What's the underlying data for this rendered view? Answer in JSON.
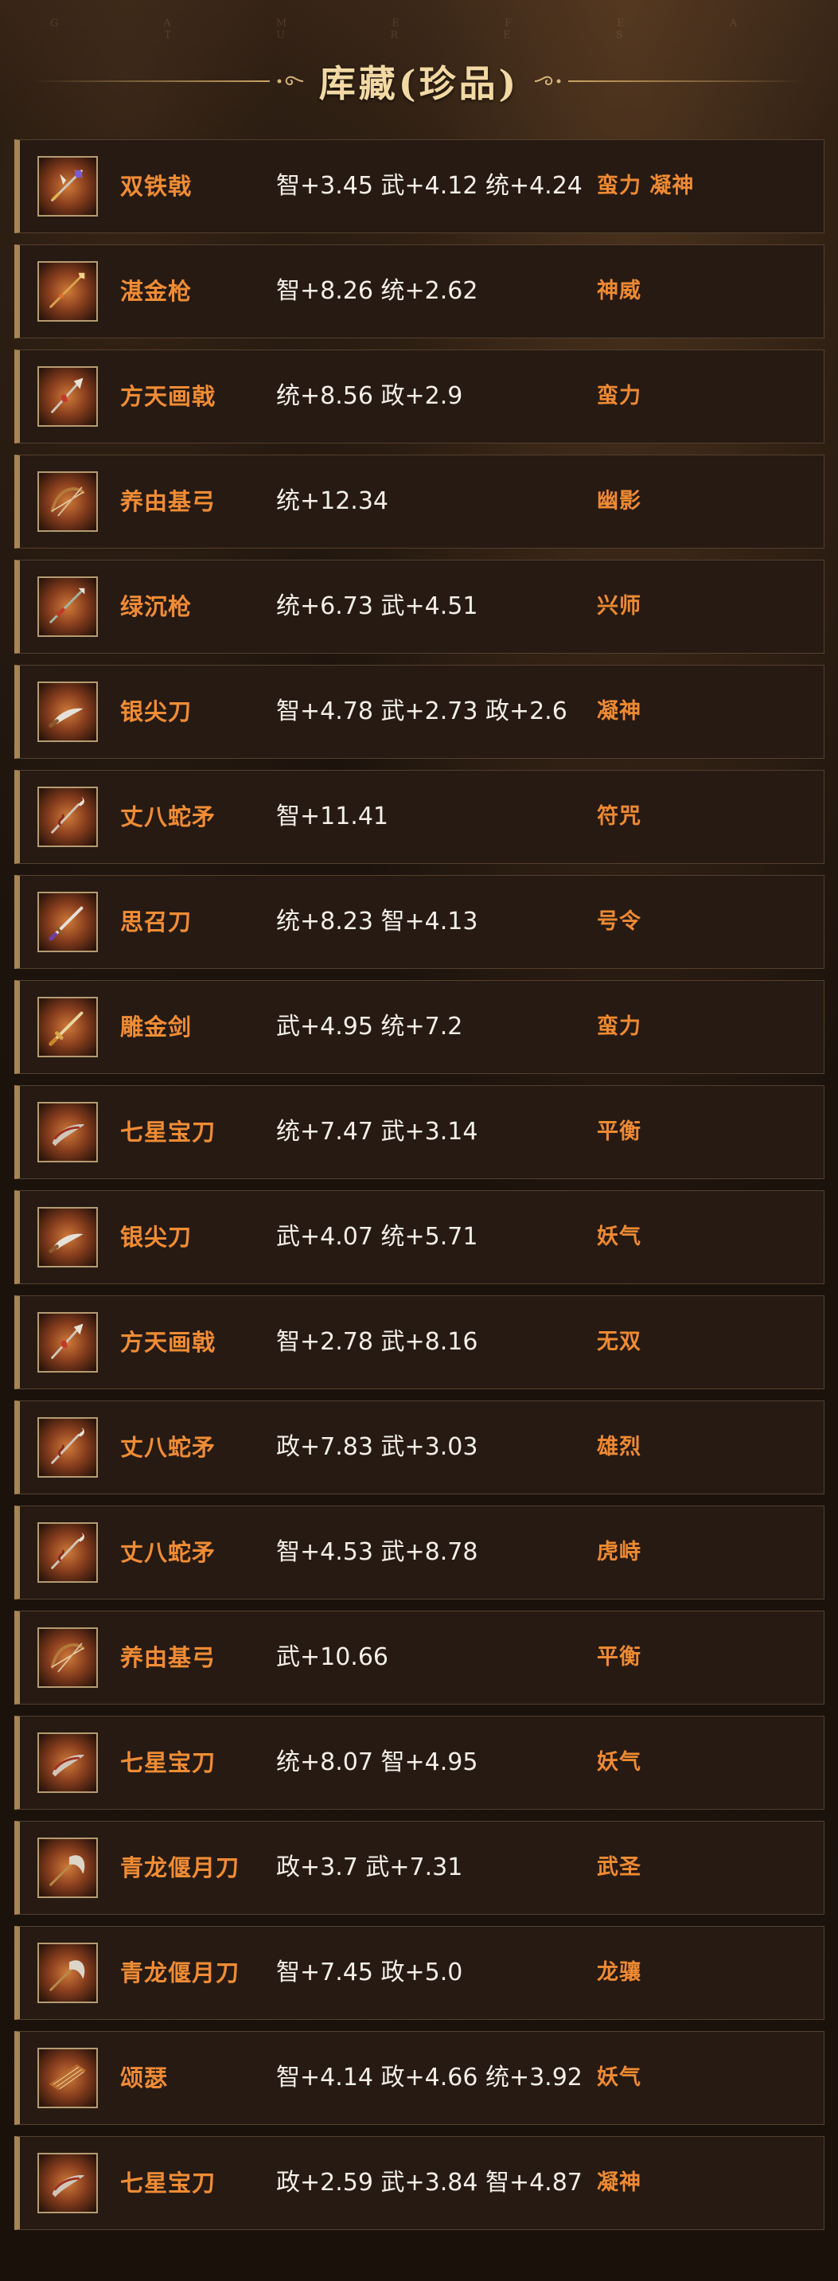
{
  "header": {
    "features_text": "G A M E  F E A T U R E S",
    "title": "库藏(珍品)"
  },
  "items": [
    {
      "name": "双铁戟",
      "stats": "智+3.45 武+4.12 统+4.24",
      "traits": "蛮力 凝神",
      "icon": "double-halberd-icon"
    },
    {
      "name": "湛金枪",
      "stats": "智+8.26 统+2.62",
      "traits": "神威",
      "icon": "golden-spear-icon"
    },
    {
      "name": "方天画戟",
      "stats": "统+8.56 政+2.9",
      "traits": "蛮力",
      "icon": "halberd-icon"
    },
    {
      "name": "养由基弓",
      "stats": "统+12.34",
      "traits": "幽影",
      "icon": "bow-icon"
    },
    {
      "name": "绿沉枪",
      "stats": "统+6.73 武+4.51",
      "traits": "兴师",
      "icon": "spear-icon"
    },
    {
      "name": "银尖刀",
      "stats": "智+4.78 武+2.73 政+2.6",
      "traits": "凝神",
      "icon": "silver-blade-icon"
    },
    {
      "name": "丈八蛇矛",
      "stats": "智+11.41",
      "traits": "符咒",
      "icon": "serpent-spear-icon"
    },
    {
      "name": "思召刀",
      "stats": "统+8.23 智+4.13",
      "traits": "号令",
      "icon": "sword-icon"
    },
    {
      "name": "雕金剑",
      "stats": "武+4.95 统+7.2",
      "traits": "蛮力",
      "icon": "gold-sword-icon"
    },
    {
      "name": "七星宝刀",
      "stats": "统+7.47 武+3.14",
      "traits": "平衡",
      "icon": "seven-star-blade-icon"
    },
    {
      "name": "银尖刀",
      "stats": "武+4.07 统+5.71",
      "traits": "妖气",
      "icon": "silver-blade-icon"
    },
    {
      "name": "方天画戟",
      "stats": "智+2.78 武+8.16",
      "traits": "无双",
      "icon": "halberd-icon"
    },
    {
      "name": "丈八蛇矛",
      "stats": "政+7.83 武+3.03",
      "traits": "雄烈",
      "icon": "serpent-spear-icon"
    },
    {
      "name": "丈八蛇矛",
      "stats": "智+4.53 武+8.78",
      "traits": "虎峙",
      "icon": "serpent-spear-icon"
    },
    {
      "name": "养由基弓",
      "stats": "武+10.66",
      "traits": "平衡",
      "icon": "bow-icon"
    },
    {
      "name": "七星宝刀",
      "stats": "统+8.07 智+4.95",
      "traits": "妖气",
      "icon": "seven-star-blade-icon"
    },
    {
      "name": "青龙偃月刀",
      "stats": "政+3.7 武+7.31",
      "traits": "武圣",
      "icon": "crescent-glaive-icon"
    },
    {
      "name": "青龙偃月刀",
      "stats": "智+7.45 政+5.0",
      "traits": "龙骧",
      "icon": "crescent-glaive-icon"
    },
    {
      "name": "颂瑟",
      "stats": "智+4.14 政+4.66 统+3.92",
      "traits": "妖气",
      "icon": "zither-icon"
    },
    {
      "name": "七星宝刀",
      "stats": "政+2.59 武+3.84 智+4.87",
      "traits": "凝神",
      "icon": "seven-star-blade-icon"
    }
  ],
  "colors": {
    "background": "#1b120c",
    "row_background": "#261a13",
    "row_accent": "#a78653",
    "name": "#f08c34",
    "trait": "#ee8a32",
    "stats": "#f4efe8",
    "title": "#f2d9a4"
  }
}
